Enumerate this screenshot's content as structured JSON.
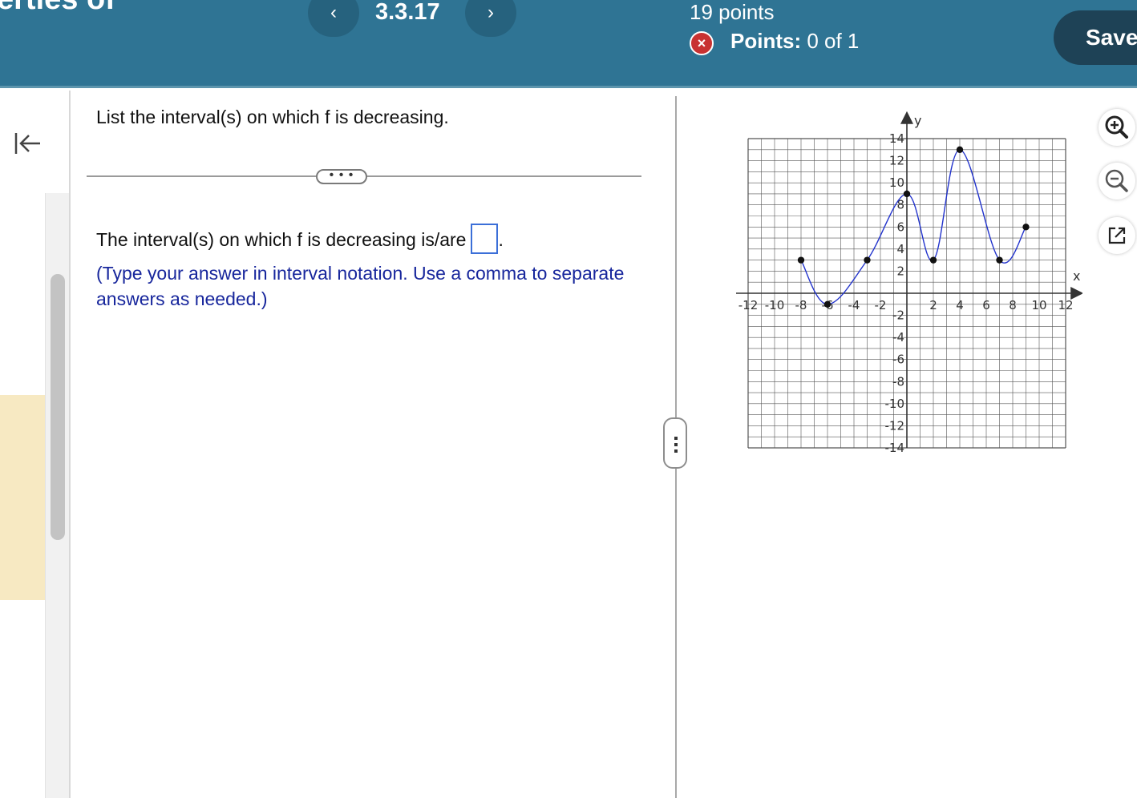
{
  "header": {
    "course_title": "erties of",
    "prev_label": "‹",
    "question_number": "3.3.17",
    "next_label": "›",
    "points_total": "19 points",
    "status_icon": "×",
    "points_label": "Points:",
    "points_value": "0 of 1",
    "save_label": "Save"
  },
  "question": {
    "prompt": "List the interval(s) on which f is decreasing.",
    "more_label": "• • •",
    "answer_prefix": "The interval(s) on which f is decreasing is/are",
    "answer_value": "",
    "answer_suffix": ".",
    "instructions": "(Type your answer in interval notation. Use a comma to separate answers as needed.)"
  },
  "graph": {
    "x_axis_label": "x",
    "y_axis_label": "y",
    "x_tick_labels": [
      "-12",
      "-10",
      "-8",
      "-6",
      "-4",
      "-2",
      "2",
      "4",
      "6",
      "8",
      "10",
      "12"
    ],
    "y_tick_labels": [
      "14",
      "12",
      "10",
      "8",
      "6",
      "4",
      "2",
      "-2",
      "-4",
      "-6",
      "-8",
      "-10",
      "-12",
      "-14"
    ],
    "x_range": [
      -12,
      12
    ],
    "y_range": [
      -14,
      14
    ],
    "grid": true,
    "curve_color": "#2233cc",
    "point_color": "#111111",
    "key_points": [
      [
        -8,
        3
      ],
      [
        -6,
        -1
      ],
      [
        -3,
        3
      ],
      [
        0,
        9
      ],
      [
        2,
        3
      ],
      [
        4,
        13
      ],
      [
        7,
        3
      ],
      [
        9,
        6
      ]
    ]
  },
  "tools": {
    "zoom_in_icon": "zoom-in-icon",
    "zoom_out_icon": "zoom-out-icon",
    "popout_icon": "external-link-icon"
  },
  "colors": {
    "header_bg": "#2f7494",
    "save_bg": "#1e4256",
    "instructions_text": "#17269c",
    "answer_box_border": "#3b6fd8",
    "status_incorrect": "#c83232"
  }
}
